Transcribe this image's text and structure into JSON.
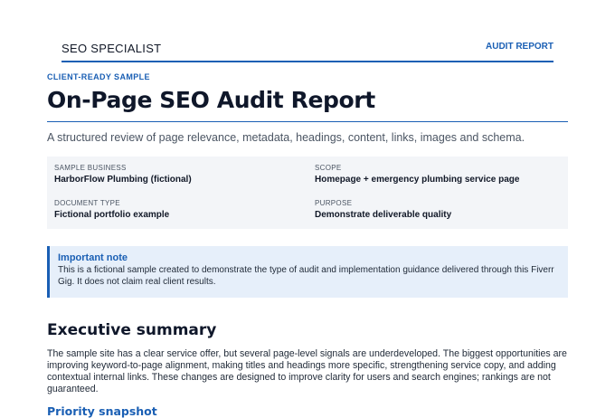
{
  "header": {
    "brand": "SEO SPECIALIST",
    "nav_link": "AUDIT REPORT"
  },
  "hero": {
    "eyebrow": "CLIENT-READY SAMPLE",
    "title": "On-Page SEO Audit Report",
    "subtitle": "A structured review of page relevance, metadata, headings, content, links, images and schema."
  },
  "meta": {
    "items": [
      {
        "label": "SAMPLE BUSINESS",
        "value": "HarborFlow Plumbing (fictional)"
      },
      {
        "label": "SCOPE",
        "value": "Homepage + emergency plumbing service page"
      },
      {
        "label": "DOCUMENT TYPE",
        "value": "Fictional portfolio example"
      },
      {
        "label": "PURPOSE",
        "value": "Demonstrate deliverable quality"
      }
    ]
  },
  "note": {
    "title": "Important note",
    "body": "This is a fictional sample created to demonstrate the type of audit and implementation guidance delivered through this Fiverr Gig. It does not claim real client results."
  },
  "summary": {
    "heading": "Executive summary",
    "body": "The sample site has a clear service offer, but several page-level signals are underdeveloped. The biggest opportunities are improving keyword-to-page alignment, making titles and headings more specific, strengthening service copy, and adding contextual internal links. These changes are designed to improve clarity for users and search engines; rankings are not guaranteed."
  },
  "priority": {
    "heading": "Priority snapshot"
  },
  "colors": {
    "accent": "#1a5fb4",
    "meta_bg": "#f3f5f8",
    "note_bg": "#e6effa"
  }
}
